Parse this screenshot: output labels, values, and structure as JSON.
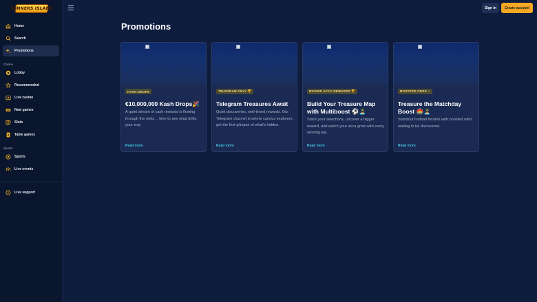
{
  "logo": {
    "text": "WINNERS ISLAND"
  },
  "sidebar": {
    "main_items": [
      {
        "label": "Home",
        "icon": "home-icon"
      },
      {
        "label": "Search",
        "icon": "search-icon"
      },
      {
        "label": "Promotions",
        "icon": "sparkles-icon",
        "active": true
      }
    ],
    "casino_label": "Casino",
    "casino_items": [
      {
        "label": "Lobby",
        "icon": "lobby-icon"
      },
      {
        "label": "Recommended",
        "icon": "star-icon"
      },
      {
        "label": "Live casino",
        "icon": "cards-icon"
      },
      {
        "label": "New games",
        "icon": "new-badge-icon"
      },
      {
        "label": "Slots",
        "icon": "slots-icon"
      },
      {
        "label": "Table games",
        "icon": "table-games-icon"
      }
    ],
    "sports_label": "Sports",
    "sports_items": [
      {
        "label": "Sports",
        "icon": "football-icon"
      },
      {
        "label": "Live events",
        "icon": "live-broadcast-icon"
      }
    ],
    "support_item": {
      "label": "Live support",
      "icon": "support-chat-icon"
    }
  },
  "header": {
    "menu_icon": "hamburger-menu-icon",
    "signin_label": "Sign in",
    "create_account_label": "Create account"
  },
  "page": {
    "title": "Promotions"
  },
  "promotions": [
    {
      "badge": "KASH DROPS",
      "title": "€10,000,000 Kash Drops🎉",
      "description": "A quiet stream of cash rewards is flowing through the reels… time to see what drifts your way",
      "cta": "Read more"
    },
    {
      "badge": "TELEGRAM ONLY 🏆",
      "title": "Telegram Treasures Await",
      "description": "Quiet discoveries, well-timed rewards. Our Telegram channel is where curious explorers get the first glimpse of what's hidden.",
      "cta": "Read more"
    },
    {
      "badge": "BIGGER ACCA REWARDS 🏆",
      "title": "Build Your Treasure Map with Multiboost ⚽🏝️",
      "description": "Stack your selections, uncover a bigger reward, and watch your acca grow with every winning leg.",
      "cta": "Read more"
    },
    {
      "badge": "BOOSTED ODDS ⚡",
      "title": "Treasure the Matchday Boost 🏟️🏝️",
      "description": "Standout football fixtures with boosted odds waiting to be discovered.",
      "cta": "Read more"
    }
  ],
  "colors": {
    "background": "#0e1c3e",
    "sidebar": "#0a152e",
    "accent": "#f5a623",
    "link": "#46c2e6",
    "icon": "#f5b324"
  }
}
